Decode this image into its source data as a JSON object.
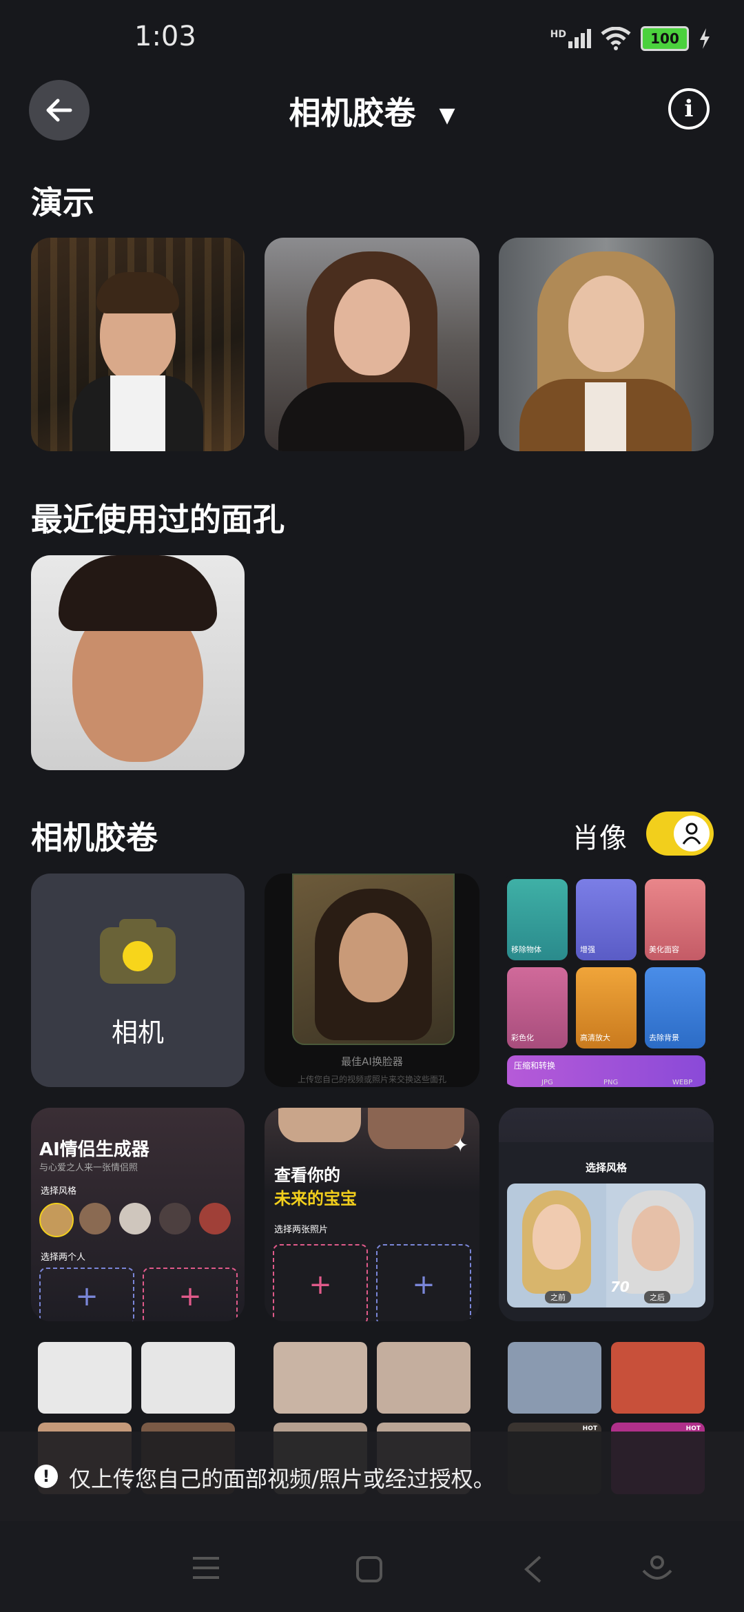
{
  "status": {
    "time": "1:03",
    "battery": "100",
    "hd": "HD"
  },
  "header": {
    "title": "相机胶卷",
    "dropdown_glyph": "▼",
    "info_glyph": "i"
  },
  "sections": {
    "demo": "演示",
    "recent": "最近使用过的面孔",
    "camera_roll": "相机胶卷",
    "portrait_label": "肖像"
  },
  "camera_tile": {
    "label": "相机"
  },
  "face_swap_card": {
    "title": "最佳AI换脸器",
    "subtitle": "上传您自己的视频或照片来交换这些面孔"
  },
  "tools_card": {
    "tools": [
      "移除物体",
      "增强",
      "美化面容",
      "彩色化",
      "高清放大",
      "去除背景"
    ],
    "convert_title": "压缩和转换",
    "formats": [
      "JPG",
      "PNG",
      "WEBP"
    ]
  },
  "couple_card": {
    "title": "AI情侣生成器",
    "subtitle": "与心爱之人来一张情侣照",
    "choose_style": "选择风格",
    "choose_two": "选择两个人"
  },
  "baby_card": {
    "title_line1": "查看你的",
    "title_line2": "未来的宝宝",
    "choose_photos": "选择两张照片"
  },
  "aging_card": {
    "title": "选择风格",
    "before": "之前",
    "after": "之后",
    "age": "70"
  },
  "hot_badge": "HOT",
  "warning": {
    "text": "仅上传您自己的面部视频/照片或经过授权。"
  },
  "colors": {
    "accent": "#f2cf1c",
    "background": "#17181c",
    "tile": "#393b45"
  }
}
